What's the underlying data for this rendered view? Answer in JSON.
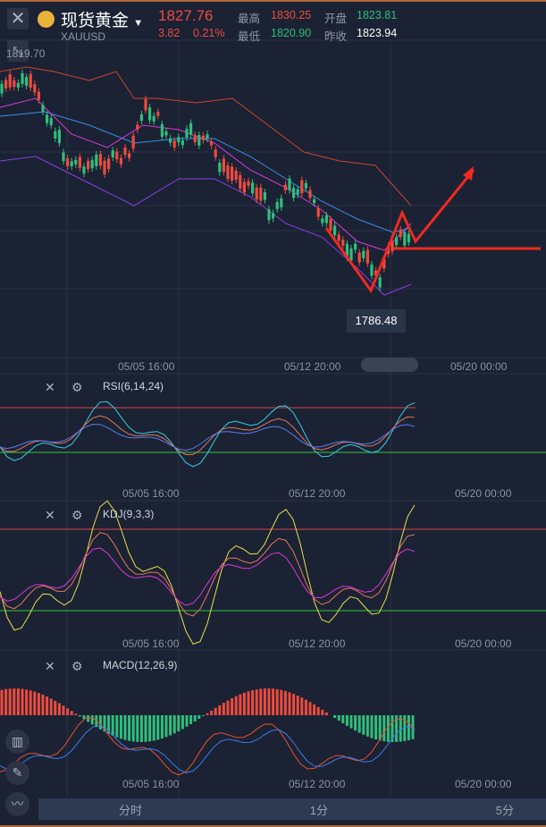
{
  "header": {
    "title": "现货黄金",
    "symbol": "XAUUSD",
    "price": "1827.76",
    "change": "3.82",
    "change_pct": "0.21%",
    "high_label": "最高",
    "high": "1830.25",
    "low_label": "最低",
    "low": "1820.90",
    "open_label": "开盘",
    "open": "1823.81",
    "prev_close_label": "昨收",
    "prev_close": "1823.94"
  },
  "main_chart": {
    "top_price_label": "1819.70",
    "low_marker": "1786.48"
  },
  "time_axis": [
    "05/05 16:00",
    "05/12 20:00",
    "05/20 00:00"
  ],
  "indicators": {
    "rsi": "RSI(6,14,24)",
    "kdj": "KDJ(9,3,3)",
    "macd": "MACD(12,26,9)"
  },
  "tabs": [
    "分时",
    "1分",
    "5分"
  ],
  "colors": {
    "up": "#ee4b3e",
    "down": "#2fbf7c",
    "bg": "#1b2234"
  }
}
